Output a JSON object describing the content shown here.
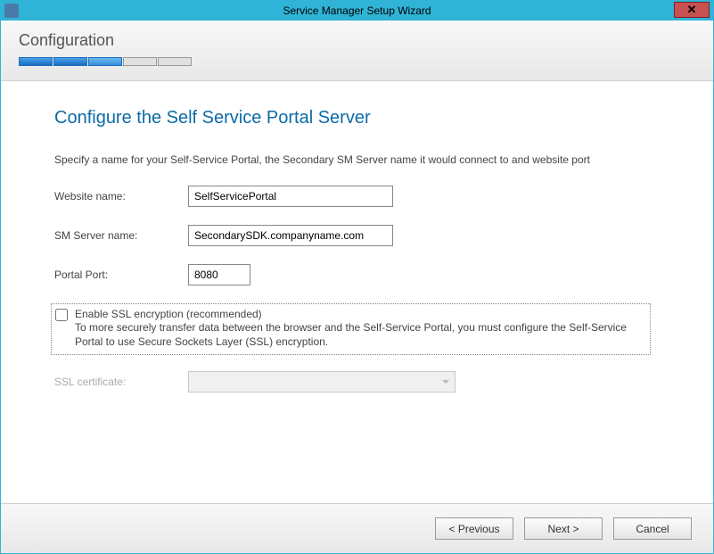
{
  "titlebar": {
    "title": "Service Manager Setup Wizard"
  },
  "header": {
    "title": "Configuration"
  },
  "page": {
    "heading": "Configure the Self Service Portal Server",
    "instruction": "Specify a name for your Self-Service Portal, the Secondary SM Server name it would connect to and website port"
  },
  "form": {
    "website_label": "Website name:",
    "website_value": "SelfServicePortal",
    "smserver_label": "SM Server name:",
    "smserver_value": "SecondarySDK.companyname.com",
    "port_label": "Portal Port:",
    "port_value": "8080",
    "ssl_title": "Enable SSL encryption (recommended)",
    "ssl_desc": "To more securely transfer data between the browser and the Self-Service Portal, you must configure the Self-Service Portal to use Secure Sockets Layer (SSL) encryption.",
    "ssl_cert_label": "SSL certificate:",
    "ssl_cert_value": ""
  },
  "footer": {
    "previous": "< Previous",
    "next": "Next >",
    "cancel": "Cancel"
  }
}
